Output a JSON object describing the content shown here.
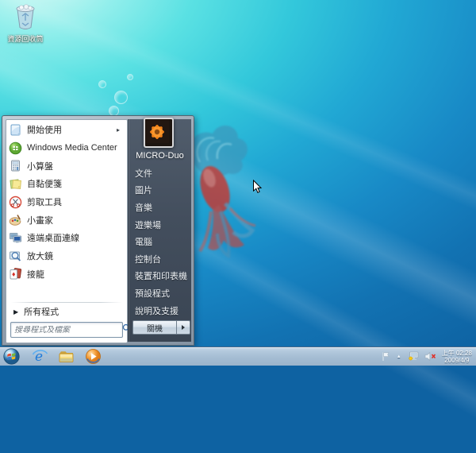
{
  "desktop": {
    "recycle_bin_label": "資源回收筒"
  },
  "start_menu": {
    "left_items": [
      {
        "label": "開始使用",
        "icon": "getting-started-icon",
        "has_submenu": true
      },
      {
        "label": "Windows Media Center",
        "icon": "media-center-icon"
      },
      {
        "label": "小算盤",
        "icon": "calculator-icon"
      },
      {
        "label": "自黏便箋",
        "icon": "sticky-notes-icon"
      },
      {
        "label": "剪取工具",
        "icon": "snipping-tool-icon"
      },
      {
        "label": "小畫家",
        "icon": "paint-icon"
      },
      {
        "label": "遠端桌面連線",
        "icon": "remote-desktop-icon"
      },
      {
        "label": "放大鏡",
        "icon": "magnifier-icon"
      },
      {
        "label": "接龍",
        "icon": "solitaire-icon"
      }
    ],
    "submenu_arrow": "▸",
    "all_programs": {
      "arrow": "▶",
      "label": "所有程式"
    },
    "search_placeholder": "搜尋程式及檔案",
    "user_name": "MICRO-Duo",
    "right_items": [
      "文件",
      "圖片",
      "音樂",
      "遊樂場",
      "電腦",
      "控制台",
      "裝置和印表機",
      "預設程式",
      "說明及支援"
    ],
    "shutdown_label": "關機"
  },
  "taskbar": {
    "tray_show_hidden": "▲",
    "clock_time": "上午 02:28",
    "clock_date": "2009/4/9"
  },
  "colors": {
    "wallpaper_topleft": "#93efec",
    "wallpaper_bottomright": "#0e62a2",
    "menu_dark_panel": "#434e5d",
    "taskbar": "#aac2d8",
    "fish_body": "#c33a35",
    "fish_fins": "#3f93b8"
  }
}
